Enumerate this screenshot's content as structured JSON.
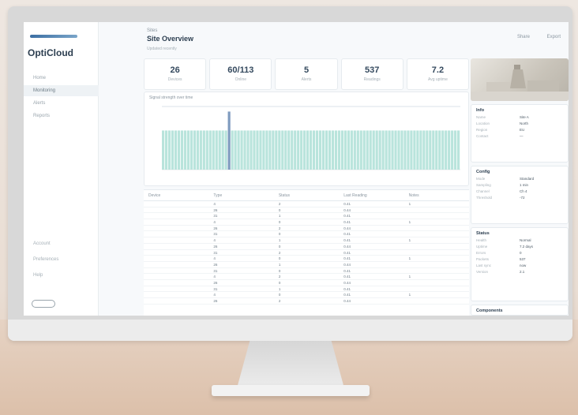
{
  "app": {
    "name": "OptiCloud"
  },
  "sidebar": {
    "items": [
      {
        "label": "Home"
      },
      {
        "label": "Monitoring"
      },
      {
        "label": "Alerts"
      },
      {
        "label": "Reports"
      }
    ],
    "bottom_links": [
      "Account",
      "Preferences",
      "Help"
    ]
  },
  "header": {
    "breadcrumb": "Sites",
    "title": "Site Overview",
    "subtitle": "Updated recently",
    "actions": [
      "Share",
      "Export"
    ]
  },
  "stats": [
    {
      "value": "26",
      "label": "Devices"
    },
    {
      "value": "60/113",
      "label": "Online"
    },
    {
      "value": "5",
      "label": "Alerts"
    },
    {
      "value": "537",
      "label": "Readings"
    },
    {
      "value": "7.2",
      "label": "Avg uptime"
    }
  ],
  "chart_data": {
    "type": "bar",
    "title": "Signal strength over time",
    "xlabel": "",
    "ylabel": "",
    "ylim": [
      0,
      100
    ],
    "bar_count": 95,
    "baseline_value": 62,
    "spike_index": 21,
    "spike_value": 92,
    "colors": {
      "bar": "#b9e4dc",
      "spike": "#7f9bbf",
      "axis": "#c9d2d8"
    }
  },
  "table": {
    "headers": [
      "Device",
      "Type",
      "Status",
      "Last Reading",
      "Notes"
    ],
    "rows": [
      [
        "",
        "4",
        "2",
        "0.41",
        "1"
      ],
      [
        "",
        "26",
        "0",
        "0.44",
        ""
      ],
      [
        "",
        "31",
        "1",
        "0.41",
        ""
      ],
      [
        "",
        "4",
        "0",
        "0.41",
        "1"
      ],
      [
        "",
        "26",
        "2",
        "0.44",
        ""
      ],
      [
        "",
        "31",
        "0",
        "0.41",
        ""
      ],
      [
        "",
        "4",
        "1",
        "0.41",
        "1"
      ],
      [
        "",
        "26",
        "0",
        "0.44",
        ""
      ],
      [
        "",
        "31",
        "2",
        "0.41",
        ""
      ],
      [
        "",
        "4",
        "0",
        "0.41",
        "1"
      ],
      [
        "",
        "26",
        "1",
        "0.44",
        ""
      ],
      [
        "",
        "31",
        "0",
        "0.41",
        ""
      ],
      [
        "",
        "4",
        "2",
        "0.41",
        "1"
      ],
      [
        "",
        "26",
        "0",
        "0.44",
        ""
      ],
      [
        "",
        "31",
        "1",
        "0.41",
        ""
      ],
      [
        "",
        "4",
        "0",
        "0.41",
        "1"
      ],
      [
        "",
        "26",
        "2",
        "0.44",
        ""
      ]
    ]
  },
  "right_panel": {
    "section1": {
      "title": "Info",
      "rows": [
        {
          "k": "Name",
          "v": "Site A"
        },
        {
          "k": "Location",
          "v": "North"
        },
        {
          "k": "Region",
          "v": "EU"
        },
        {
          "k": "Contact",
          "v": "—"
        }
      ]
    },
    "section2": {
      "title": "Config",
      "rows": [
        {
          "k": "Mode",
          "v": "Standard"
        },
        {
          "k": "Sampling",
          "v": "1 min"
        },
        {
          "k": "Channel",
          "v": "Ch 4"
        },
        {
          "k": "Threshold",
          "v": "-72"
        }
      ]
    },
    "section3": {
      "title": "Status",
      "rows": [
        {
          "k": "Health",
          "v": "Normal"
        },
        {
          "k": "Uptime",
          "v": "7.2 days"
        },
        {
          "k": "Errors",
          "v": "0"
        },
        {
          "k": "Packets",
          "v": "537"
        },
        {
          "k": "Last sync",
          "v": "now"
        },
        {
          "k": "Version",
          "v": "2.1"
        }
      ]
    },
    "footer": "Components"
  }
}
